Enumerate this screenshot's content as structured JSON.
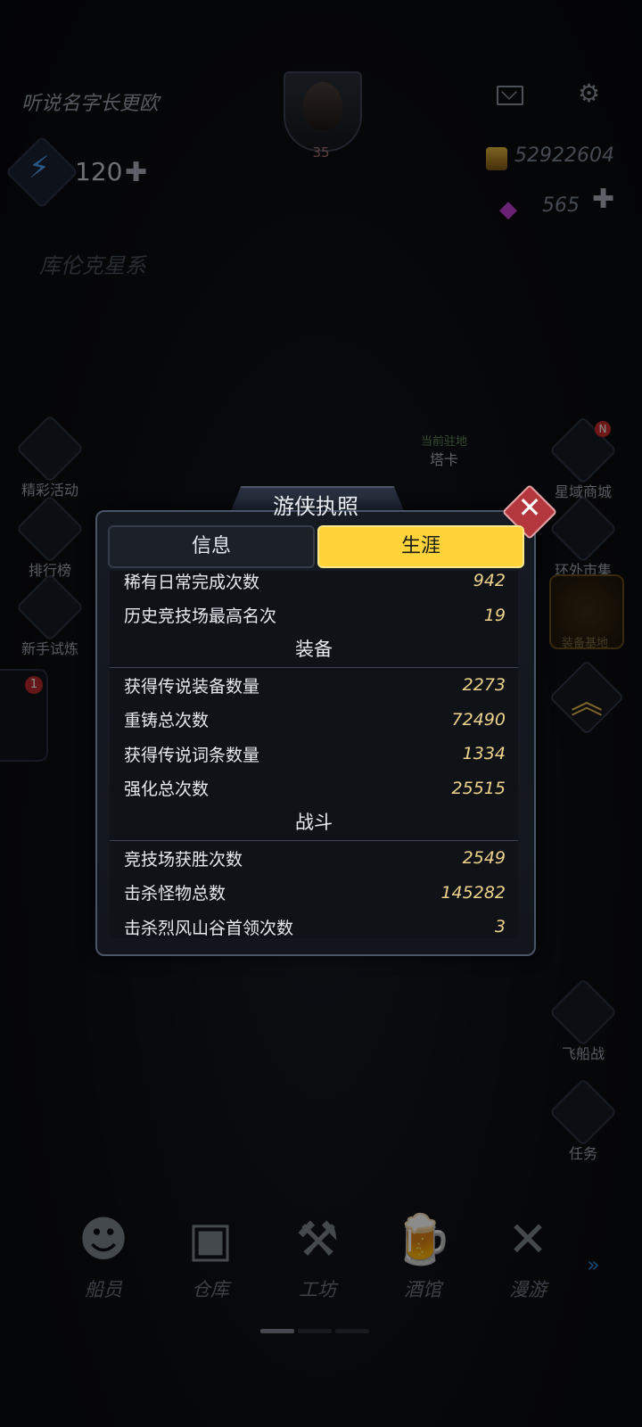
{
  "header": {
    "player_name": "听说名字长更欧",
    "level": "35",
    "energy": "120",
    "gold": "52922604",
    "gems": "565",
    "region": "库伦克星系"
  },
  "left_menu": {
    "events": "精彩活动",
    "ranking": "排行榜",
    "trial": "新手试炼",
    "chat_badge": "1"
  },
  "right_menu": {
    "shop": "星域商城",
    "shop_badge": "N",
    "market": "环外市集",
    "equip_base": "装备基地",
    "ship_battle": "飞船战",
    "tasks": "任务"
  },
  "station": {
    "label": "当前驻地",
    "name": "塔卡"
  },
  "modal": {
    "title": "游侠执照",
    "tabs": [
      "信息",
      "生涯"
    ],
    "active_tab": "生涯",
    "top_rows": [
      {
        "label": "稀有日常完成次数",
        "value": "942"
      },
      {
        "label": "历史竞技场最高名次",
        "value": "19"
      }
    ],
    "equipment_title": "装备",
    "equipment_rows": [
      {
        "label": "获得传说装备数量",
        "value": "2273"
      },
      {
        "label": "重铸总次数",
        "value": "72490"
      },
      {
        "label": "获得传说词条数量",
        "value": "1334"
      },
      {
        "label": "强化总次数",
        "value": "25515"
      }
    ],
    "battle_title": "战斗",
    "battle_rows": [
      {
        "label": "竞技场获胜次数",
        "value": "2549"
      },
      {
        "label": "击杀怪物总数",
        "value": "145282"
      },
      {
        "label": "击杀烈风山谷首领次数",
        "value": "3"
      }
    ]
  },
  "bottom_nav": [
    "船员",
    "仓库",
    "工坊",
    "酒馆",
    "漫游"
  ]
}
